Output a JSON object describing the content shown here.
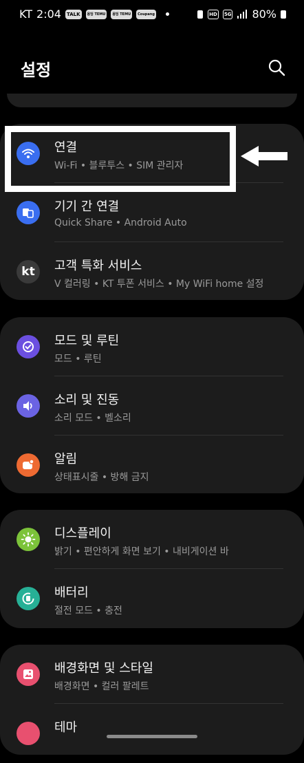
{
  "status_bar": {
    "carrier": "KT",
    "time": "2:04",
    "battery": "80%",
    "net": "5G",
    "hd": "HD",
    "notif_icons": [
      "TALK",
      "옹딩 TEMU",
      "옹딩 TEMU",
      "Coupang"
    ]
  },
  "header": {
    "title": "설정"
  },
  "sections": [
    {
      "items": [
        {
          "title": "연결",
          "sub": "Wi-Fi • 블루투스 • SIM 관리자",
          "icon": "wifi-icon",
          "color": "#3a6ef0"
        },
        {
          "title": "기기 간 연결",
          "sub": "Quick Share • Android Auto",
          "icon": "devices-icon",
          "color": "#3a6ef0"
        },
        {
          "title": "고객 특화 서비스",
          "sub": "V 컬러링 • KT 투폰 서비스 • My WiFi home 설정",
          "icon": "kt-logo-icon",
          "color": "#3a3a3a"
        }
      ]
    },
    {
      "items": [
        {
          "title": "모드 및 루틴",
          "sub": "모드 • 루틴",
          "icon": "mode-routine-icon",
          "color": "#6b4fe0"
        },
        {
          "title": "소리 및 진동",
          "sub": "소리 모드 • 벨소리",
          "icon": "sound-icon",
          "color": "#6b63e3"
        },
        {
          "title": "알림",
          "sub": "상태표시줄 • 방해 금지",
          "icon": "notification-icon",
          "color": "#ee6a32"
        }
      ]
    },
    {
      "items": [
        {
          "title": "디스플레이",
          "sub": "밝기 • 편안하게 화면 보기 • 내비게이션 바",
          "icon": "display-icon",
          "color": "#7cc33a"
        },
        {
          "title": "배터리",
          "sub": "절전 모드 • 충전",
          "icon": "battery-icon",
          "color": "#27b096"
        }
      ]
    },
    {
      "items": [
        {
          "title": "배경화면 및 스타일",
          "sub": "배경화면 • 컬러 팔레트",
          "icon": "wallpaper-icon",
          "color": "#e8506f"
        },
        {
          "title": "테마",
          "sub": "",
          "icon": "theme-icon",
          "color": "#e8506f"
        }
      ]
    }
  ]
}
